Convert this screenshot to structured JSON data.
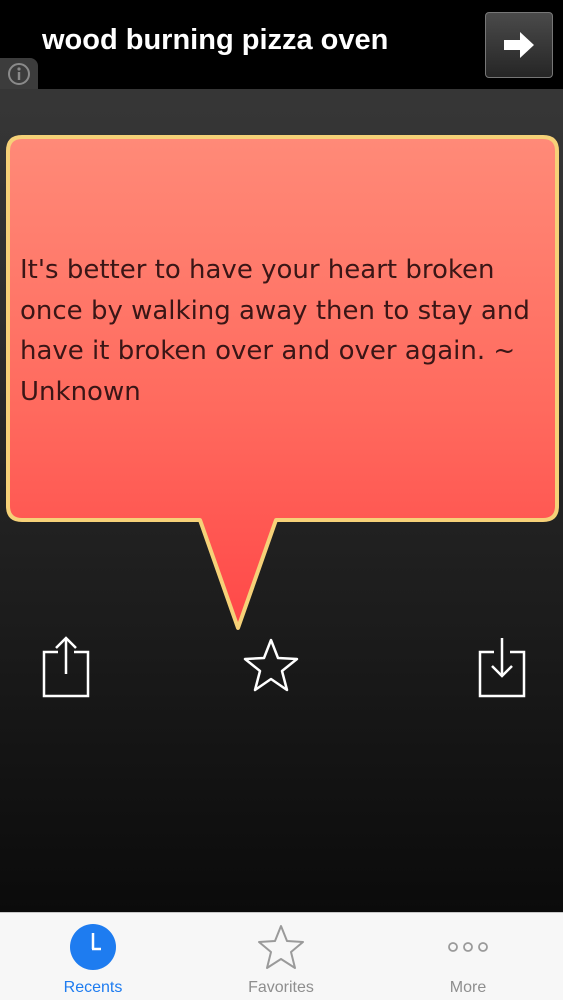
{
  "header": {
    "title": "wood burning pizza oven",
    "next_icon": "arrow-right-icon",
    "info_icon": "info-icon"
  },
  "quote": {
    "text": "It's better to have your heart broken once by walking away then to stay and have it broken over and over again.  ~ Unknown",
    "bubble_color": "#ff6a5e",
    "border_color": "#f6d178"
  },
  "actions": {
    "share_icon": "share-icon",
    "favorite_icon": "star-icon",
    "save_icon": "download-icon"
  },
  "tabbar": {
    "accent": "#1e7cf0",
    "tabs": [
      {
        "label": "Recents",
        "icon": "clock-icon",
        "active": true
      },
      {
        "label": "Favorites",
        "icon": "star-icon",
        "active": false
      },
      {
        "label": "More",
        "icon": "more-icon",
        "active": false
      }
    ]
  }
}
